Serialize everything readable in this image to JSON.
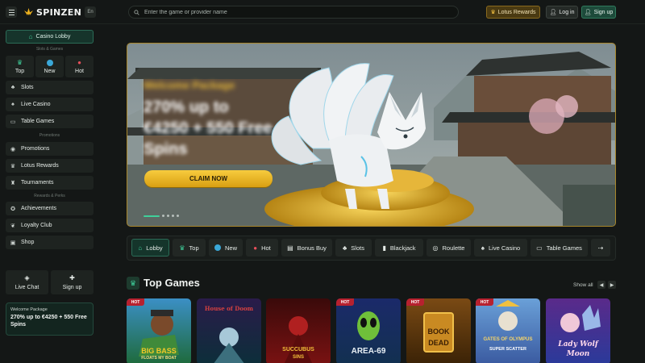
{
  "header": {
    "brand": "SPINZEN",
    "lang": "En",
    "search_placeholder": "Enter the game or provider name",
    "rewards_label": "Lotus Rewards",
    "login_label": "Log in",
    "signup_label": "Sign up"
  },
  "sidebar": {
    "lobby_label": "Casino Lobby",
    "slots_games_label": "Slots & Games",
    "quick": [
      {
        "label": "Top",
        "icon": "crown-icon"
      },
      {
        "label": "New",
        "icon": "new-icon"
      },
      {
        "label": "Hot",
        "icon": "fire-icon"
      }
    ],
    "games": [
      {
        "label": "Slots",
        "icon": "slots-icon"
      },
      {
        "label": "Live Casino",
        "icon": "live-casino-icon"
      },
      {
        "label": "Table Games",
        "icon": "table-games-icon"
      }
    ],
    "promotions_section_label": "Promotions",
    "promos": [
      {
        "label": "Promotions",
        "icon": "promotions-icon"
      },
      {
        "label": "Lotus Rewards",
        "icon": "crown-icon"
      },
      {
        "label": "Tournaments",
        "icon": "trophy-icon"
      }
    ],
    "rewards_section_label": "Rewards & Perks",
    "perks": [
      {
        "label": "Achievements",
        "icon": "achievements-icon"
      },
      {
        "label": "Loyalty Club",
        "icon": "loyalty-icon"
      },
      {
        "label": "Shop",
        "icon": "shop-icon"
      }
    ],
    "live_chat_label": "Live Chat",
    "signup_label": "Sign up",
    "welcome": {
      "title": "Welcome Package",
      "offer": "270% up to €4250 + 550 Free Spins"
    }
  },
  "banner": {
    "subtitle": "Welcome Package",
    "headline": "270% up to €4250 + 550 Free Spins",
    "cta": "CLAIM NOW"
  },
  "tabs": [
    {
      "label": "Lobby",
      "icon": "lobby-icon",
      "active": true
    },
    {
      "label": "Top",
      "icon": "crown-icon"
    },
    {
      "label": "New",
      "icon": "new-icon"
    },
    {
      "label": "Hot",
      "icon": "fire-icon"
    },
    {
      "label": "Bonus Buy",
      "icon": "bonus-buy-icon"
    },
    {
      "label": "Slots",
      "icon": "slots-icon"
    },
    {
      "label": "Blackjack",
      "icon": "blackjack-icon"
    },
    {
      "label": "Roulette",
      "icon": "roulette-icon"
    },
    {
      "label": "Live Casino",
      "icon": "live-casino-icon"
    },
    {
      "label": "Table Games",
      "icon": "table-games-icon"
    }
  ],
  "top_games": {
    "title": "Top Games",
    "show_all": "Show all",
    "hot_badge": "HOT",
    "games": [
      {
        "name": "Big Bass Floats My Boat",
        "title_line1": "BIG BASS",
        "title_line2": "FLOATS MY BOAT",
        "hot": true
      },
      {
        "name": "House of Doom",
        "title_line1": "House of Doom",
        "title_line2": "",
        "hot": false
      },
      {
        "name": "Succubus Sins",
        "title_line1": "SUCCUBUS",
        "title_line2": "SINS",
        "hot": false
      },
      {
        "name": "Area-69",
        "title_line1": "AREA-69",
        "title_line2": "",
        "hot": true
      },
      {
        "name": "Book of Dead",
        "title_line1": "BOOK",
        "title_line2": "DEAD",
        "hot": true
      },
      {
        "name": "Gates of Olympus Super Scatter",
        "title_line1": "GATES OF OLYMPUS",
        "title_line2": "SUPER SCATTER",
        "hot": true
      },
      {
        "name": "Lady Wolf Moon",
        "title_line1": "Lady Wolf",
        "title_line2": "Moon",
        "hot": false
      }
    ]
  },
  "colors": {
    "accent": "#2b6b56",
    "gold": "#e3b53a",
    "hot": "#b7212f",
    "background": "#141716"
  }
}
